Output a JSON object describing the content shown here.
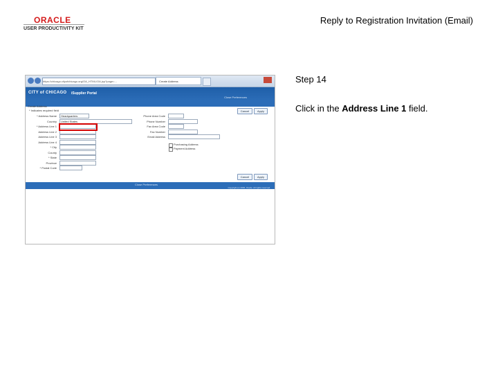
{
  "header": {
    "brand": "ORACLE",
    "product": "USER PRODUCTIVITY KIT",
    "doc_title": "Reply to Registration Invitation (Email)"
  },
  "step": {
    "label": "Step 14",
    "instruction_prefix": "Click in the ",
    "instruction_target": "Address Line 1",
    "instruction_suffix": " field."
  },
  "browser": {
    "url": "https://chicago.cityofchicago.org/OA_HTML/OA.jsp?page=...",
    "tab_title": "Create Address"
  },
  "app": {
    "logo": "CITY of CHICAGO",
    "portal": "iSupplier Portal",
    "nav_links": "Close  Preferences",
    "footer_links": "Close  Preferences",
    "copyright": "Copyright (c) 2006, Oracle. All rights reserved."
  },
  "form": {
    "title": "Create Address",
    "required_note": "* Indicates required field",
    "cancel": "Cancel",
    "apply": "Apply",
    "left_fields": [
      {
        "label": "* Address Name",
        "value": "Headquarters"
      },
      {
        "label": "Country",
        "value": "United States"
      },
      {
        "label": "* Address Line 1",
        "value": ""
      },
      {
        "label": "Address Line 2",
        "value": ""
      },
      {
        "label": "Address Line 3",
        "value": ""
      },
      {
        "label": "Address Line 4",
        "value": ""
      },
      {
        "label": "* City",
        "value": ""
      },
      {
        "label": "County",
        "value": ""
      },
      {
        "label": "* State",
        "value": ""
      },
      {
        "label": "Province",
        "value": ""
      },
      {
        "label": "* Postal Code",
        "value": ""
      }
    ],
    "right_fields": [
      {
        "label": "Phone Area Code",
        "value": ""
      },
      {
        "label": "Phone Number",
        "value": ""
      },
      {
        "label": "Fax Area Code",
        "value": ""
      },
      {
        "label": "Fax Number",
        "value": ""
      },
      {
        "label": "Email Address",
        "value": ""
      }
    ],
    "checkboxes": [
      "Purchasing Address",
      "Payment Address"
    ]
  }
}
